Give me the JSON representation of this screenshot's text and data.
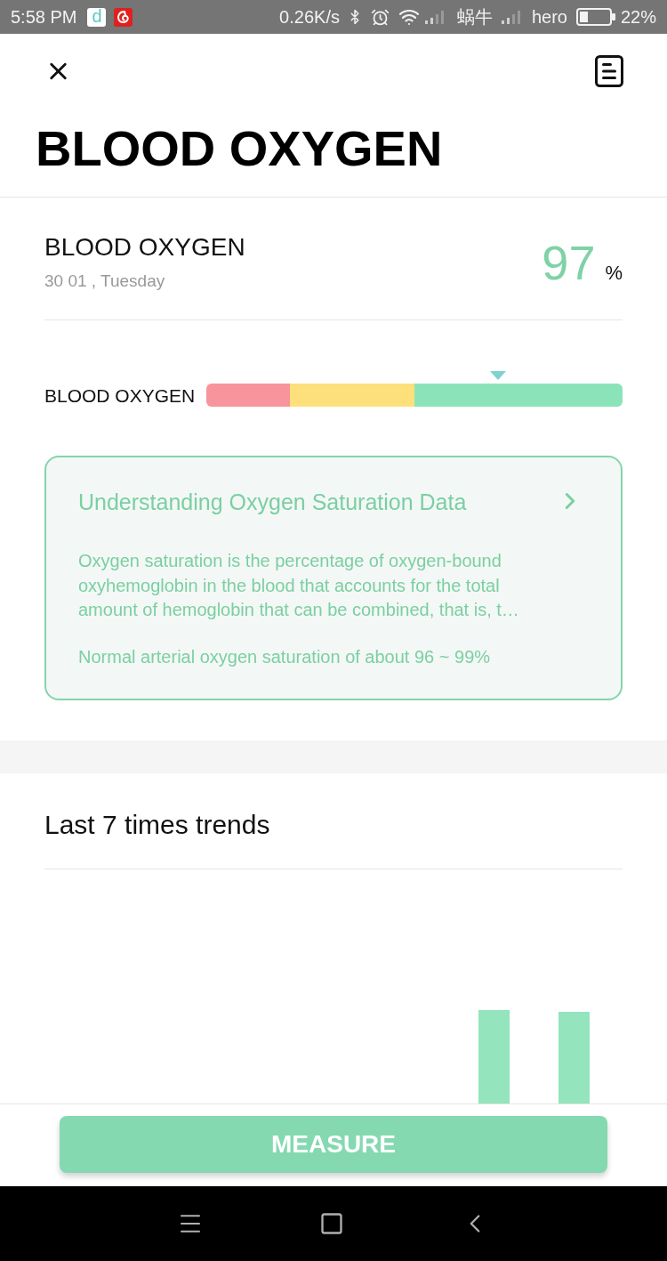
{
  "status_bar": {
    "time": "5:58 PM",
    "apps": [
      {
        "kind": "letter",
        "letter": "d"
      },
      {
        "kind": "swirl"
      }
    ],
    "net_speed": "0.26K/s",
    "carrier_1": "蜗牛",
    "carrier_2": "hero",
    "battery": "22%"
  },
  "header": {
    "title": "BLOOD OXYGEN"
  },
  "reading": {
    "label": "BLOOD OXYGEN",
    "date": "30 01 , Tuesday",
    "value": "97",
    "unit": "%"
  },
  "scale": {
    "label": "BLOOD OXYGEN",
    "segments": [
      {
        "color": "#f8949b"
      },
      {
        "color": "#fde07c"
      },
      {
        "color": "#8be4b9"
      }
    ],
    "level": 0.7
  },
  "info_card": {
    "title": "Understanding Oxygen Saturation Data",
    "description_lines": [
      "Oxygen saturation is the percentage of oxygen-bound",
      "oxyhemoglobin in the blood that accounts for the total",
      "amount of hemoglobin that can be combined, that is, t…"
    ],
    "note": "Normal arterial oxygen saturation of about 96 ~ 99%"
  },
  "trends": {
    "title": "Last 7 times trends"
  },
  "measure_button": {
    "label": "MEASURE"
  }
}
